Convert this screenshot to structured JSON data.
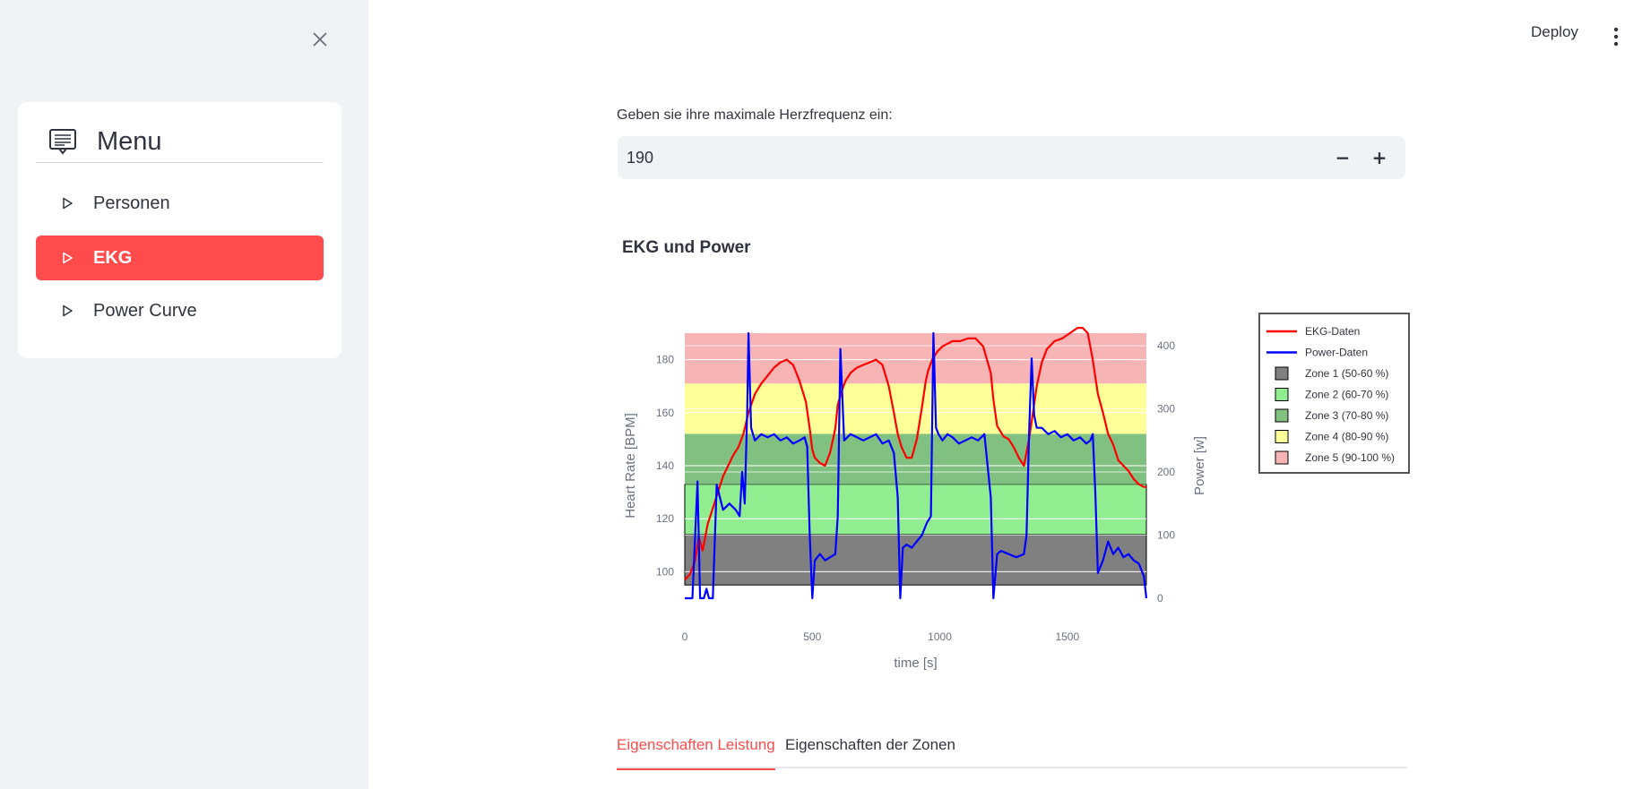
{
  "header": {
    "deploy_label": "Deploy"
  },
  "sidebar": {
    "title": "Menu",
    "items": [
      {
        "label": "Personen",
        "active": false
      },
      {
        "label": "EKG",
        "active": true
      },
      {
        "label": "Power Curve",
        "active": false
      }
    ]
  },
  "main": {
    "hr_input": {
      "label": "Geben sie ihre maximale Herzfrequenz ein:",
      "value": "190",
      "minus": "−",
      "plus": "+"
    },
    "chart_title": "EKG und Power",
    "tabs": [
      {
        "label": "Eigenschaften Leistung",
        "active": true
      },
      {
        "label": "Eigenschaften der Zonen",
        "active": false
      }
    ]
  },
  "colors": {
    "accent": "#ff4b4b",
    "ekg": "#ff0000",
    "power": "#0000ff",
    "sidebar_bg": "#f0f2f6"
  },
  "chart_data": {
    "type": "line",
    "title": "",
    "xlabel": "time [s]",
    "ylabel": "Heart Rate [BPM]",
    "y2label": "Power [w]",
    "xlim": [
      0,
      1810
    ],
    "ylim": [
      90,
      190
    ],
    "y2lim": [
      0,
      420
    ],
    "x_ticks": [
      0,
      500,
      1000,
      1500
    ],
    "y_ticks": [
      100,
      120,
      140,
      160,
      180
    ],
    "y2_ticks": [
      0,
      100,
      200,
      300,
      400
    ],
    "grid": true,
    "legend_position": "right",
    "zones": [
      {
        "name": "Zone 1 (50-60 %)",
        "from": 95,
        "to": 114,
        "color": "#808080"
      },
      {
        "name": "Zone 2 (60-70 %)",
        "from": 114,
        "to": 133,
        "color": "#90ee90"
      },
      {
        "name": "Zone 3 (70-80 %)",
        "from": 133,
        "to": 152,
        "color": "#80c080"
      },
      {
        "name": "Zone 4 (80-90 %)",
        "from": 152,
        "to": 171,
        "color": "#ffff99"
      },
      {
        "name": "Zone 5 (90-100 %)",
        "from": 171,
        "to": 190,
        "color": "#f7b4b4"
      }
    ],
    "series": [
      {
        "name": "EKG-Daten",
        "axis": "left",
        "color": "#ff0000",
        "x": [
          0,
          20,
          40,
          55,
          70,
          90,
          110,
          130,
          150,
          170,
          190,
          210,
          230,
          250,
          275,
          300,
          325,
          350,
          375,
          400,
          425,
          450,
          475,
          490,
          500,
          510,
          530,
          550,
          570,
          590,
          600,
          615,
          630,
          650,
          675,
          700,
          725,
          750,
          775,
          800,
          820,
          835,
          850,
          870,
          890,
          910,
          930,
          945,
          955,
          970,
          990,
          1010,
          1030,
          1050,
          1080,
          1110,
          1140,
          1170,
          1200,
          1210,
          1225,
          1250,
          1270,
          1290,
          1310,
          1330,
          1350,
          1365,
          1380,
          1400,
          1420,
          1450,
          1480,
          1510,
          1540,
          1560,
          1580,
          1600,
          1620,
          1640,
          1660,
          1680,
          1700,
          1720,
          1740,
          1760,
          1780,
          1800,
          1810
        ],
        "values": [
          97,
          99,
          104,
          113,
          108,
          118,
          124,
          130,
          136,
          140,
          144,
          147,
          152,
          160,
          167,
          171,
          174,
          177,
          179,
          180,
          178,
          172,
          164,
          154,
          146,
          143,
          141,
          140,
          145,
          154,
          163,
          168,
          172,
          175,
          177,
          178,
          179,
          180,
          178,
          170,
          160,
          152,
          147,
          143,
          143,
          150,
          162,
          172,
          176,
          180,
          183,
          185,
          186,
          187,
          187,
          188,
          188,
          185,
          175,
          165,
          155,
          151,
          150,
          147,
          143,
          140,
          150,
          160,
          170,
          179,
          184,
          187,
          188,
          190,
          192,
          192,
          190,
          180,
          167,
          160,
          152,
          148,
          142,
          140,
          138,
          135,
          133,
          132,
          132
        ]
      },
      {
        "name": "Power-Daten",
        "axis": "right",
        "color": "#0000ff",
        "x": [
          0,
          30,
          50,
          60,
          75,
          85,
          95,
          110,
          125,
          150,
          175,
          200,
          215,
          225,
          235,
          245,
          250,
          260,
          275,
          300,
          325,
          350,
          375,
          400,
          425,
          450,
          470,
          480,
          490,
          500,
          510,
          530,
          550,
          570,
          590,
          600,
          610,
          625,
          650,
          675,
          700,
          725,
          750,
          775,
          800,
          820,
          835,
          845,
          855,
          870,
          890,
          910,
          930,
          950,
          965,
          975,
          985,
          995,
          1010,
          1030,
          1050,
          1075,
          1100,
          1125,
          1150,
          1175,
          1200,
          1210,
          1225,
          1240,
          1270,
          1300,
          1330,
          1340,
          1350,
          1360,
          1370,
          1380,
          1400,
          1425,
          1450,
          1475,
          1500,
          1525,
          1550,
          1575,
          1590,
          1600,
          1610,
          1620,
          1640,
          1660,
          1680,
          1700,
          1720,
          1740,
          1760,
          1780,
          1800,
          1810
        ],
        "values": [
          0,
          0,
          185,
          0,
          0,
          15,
          0,
          0,
          180,
          140,
          150,
          140,
          130,
          200,
          150,
          300,
          420,
          270,
          250,
          260,
          255,
          260,
          250,
          255,
          245,
          250,
          255,
          240,
          100,
          0,
          60,
          70,
          60,
          65,
          70,
          130,
          395,
          250,
          260,
          255,
          250,
          255,
          260,
          245,
          250,
          230,
          160,
          0,
          80,
          85,
          80,
          90,
          100,
          120,
          130,
          420,
          270,
          260,
          250,
          260,
          255,
          245,
          250,
          255,
          250,
          260,
          160,
          0,
          70,
          75,
          70,
          65,
          70,
          100,
          260,
          380,
          290,
          270,
          270,
          260,
          265,
          255,
          260,
          250,
          255,
          245,
          250,
          260,
          165,
          40,
          60,
          90,
          70,
          80,
          65,
          70,
          60,
          55,
          35,
          0
        ]
      }
    ]
  }
}
